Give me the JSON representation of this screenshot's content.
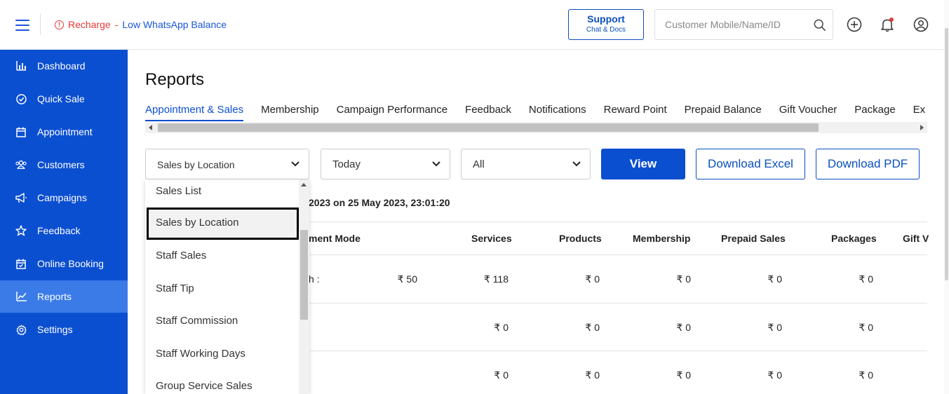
{
  "header": {
    "alert_recharge": "Recharge",
    "alert_separator": "-",
    "alert_low": "Low WhatsApp Balance",
    "support_title": "Support",
    "support_sub": "Chat & Docs",
    "search_placeholder": "Customer Mobile/Name/ID"
  },
  "sidebar": {
    "items": [
      {
        "label": "Dashboard",
        "icon": "bar-chart-icon"
      },
      {
        "label": "Quick Sale",
        "icon": "check-circle-icon"
      },
      {
        "label": "Appointment",
        "icon": "calendar-icon"
      },
      {
        "label": "Customers",
        "icon": "users-icon"
      },
      {
        "label": "Campaigns",
        "icon": "megaphone-icon"
      },
      {
        "label": "Feedback",
        "icon": "star-icon"
      },
      {
        "label": "Online Booking",
        "icon": "calendar-check-icon"
      },
      {
        "label": "Reports",
        "icon": "line-chart-icon",
        "active": true
      },
      {
        "label": "Settings",
        "icon": "gear-icon"
      }
    ],
    "accent_color": "#0b4fd1",
    "active_color": "#3b7be8"
  },
  "main": {
    "title": "Reports",
    "tabs": [
      "Appointment & Sales",
      "Membership",
      "Campaign Performance",
      "Feedback",
      "Notifications",
      "Reward Point",
      "Prepaid Balance",
      "Gift Voucher",
      "Package",
      "Ex"
    ],
    "filters": {
      "report_type": "Sales by Location",
      "period": "Today",
      "scope": "All"
    },
    "buttons": {
      "view": "View",
      "download_excel": "Download Excel",
      "download_pdf": "Download PDF"
    },
    "report_info": "2023 on 25 May 2023, 23:01:20",
    "table": {
      "headers": [
        "ment Mode",
        "Services",
        "Products",
        "Membership",
        "Prepaid Sales",
        "Packages",
        "Gift V"
      ],
      "rows": [
        {
          "mode": "h :",
          "amount": "₹ 50",
          "services": "₹ 118",
          "products": "₹ 0",
          "membership": "₹ 0",
          "prepaid": "₹ 0",
          "packages": "₹ 0"
        },
        {
          "services": "₹ 0",
          "products": "₹ 0",
          "membership": "₹ 0",
          "prepaid": "₹ 0",
          "packages": "₹ 0"
        },
        {
          "services": "₹ 0",
          "products": "₹ 0",
          "membership": "₹ 0",
          "prepaid": "₹ 0",
          "packages": "₹ 0"
        }
      ]
    },
    "dropdown_options": [
      "Sales List",
      "Sales by Location",
      "Staff Sales",
      "Staff Tip",
      "Staff Commission",
      "Staff Working Days",
      "Group Service Sales"
    ],
    "dropdown_selected_index": 1
  }
}
